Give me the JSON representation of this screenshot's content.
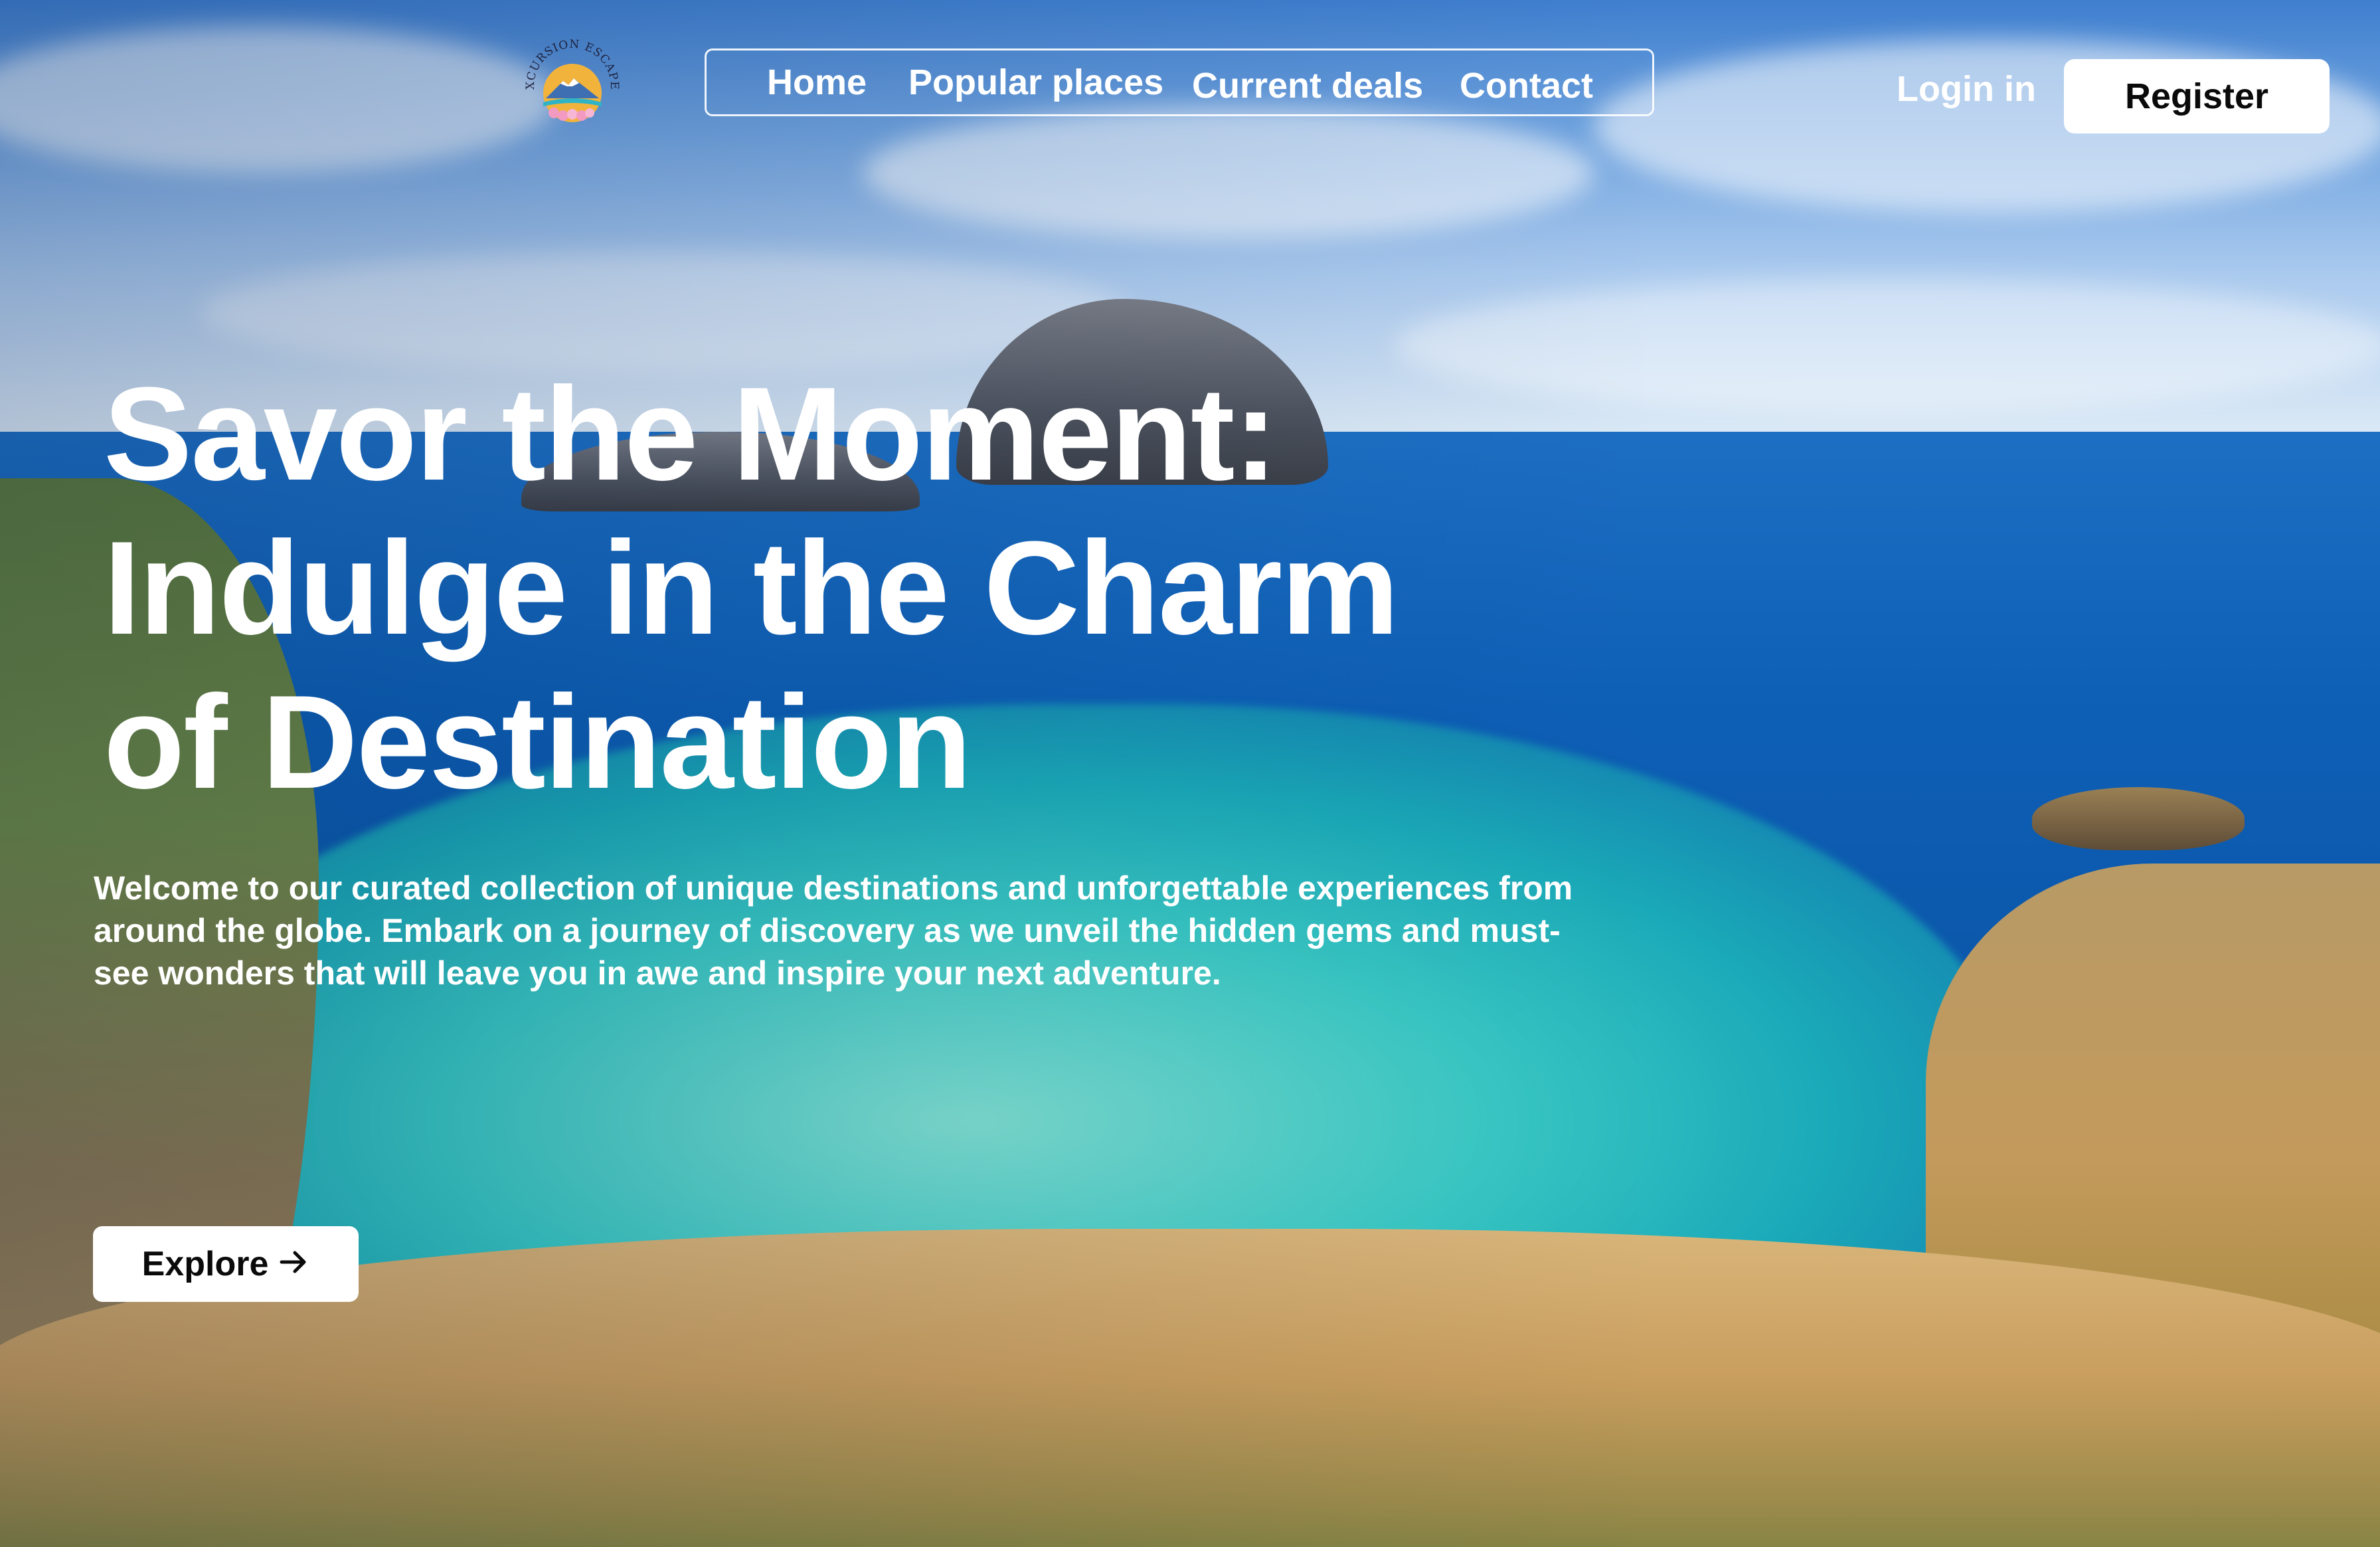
{
  "brand": {
    "logo_text": "EXCURSION ESCAPES",
    "accent": "#f2b33d",
    "logo_pink": "#f29ac2"
  },
  "nav": {
    "items": [
      {
        "label": "Home"
      },
      {
        "label": "Popular places"
      },
      {
        "label": "Current deals"
      },
      {
        "label": "Contact"
      }
    ]
  },
  "auth": {
    "login_label": "Login in",
    "register_label": "Register"
  },
  "hero": {
    "headline_lines": [
      "Savor the Moment:",
      "Indulge in the Charm",
      "of Destination"
    ],
    "description": "Welcome to our curated collection of unique destinations and unforgettable experiences from around the globe. Embark on a journey of discovery as we unveil the hidden gems and must-see wonders that will leave you in awe and inspire your next adventure.",
    "cta_label": "Explore",
    "cta_icon": "arrow-right-icon"
  },
  "colors": {
    "button_bg": "#ffffff",
    "button_text": "#0a0a0a",
    "text": "#ffffff"
  }
}
